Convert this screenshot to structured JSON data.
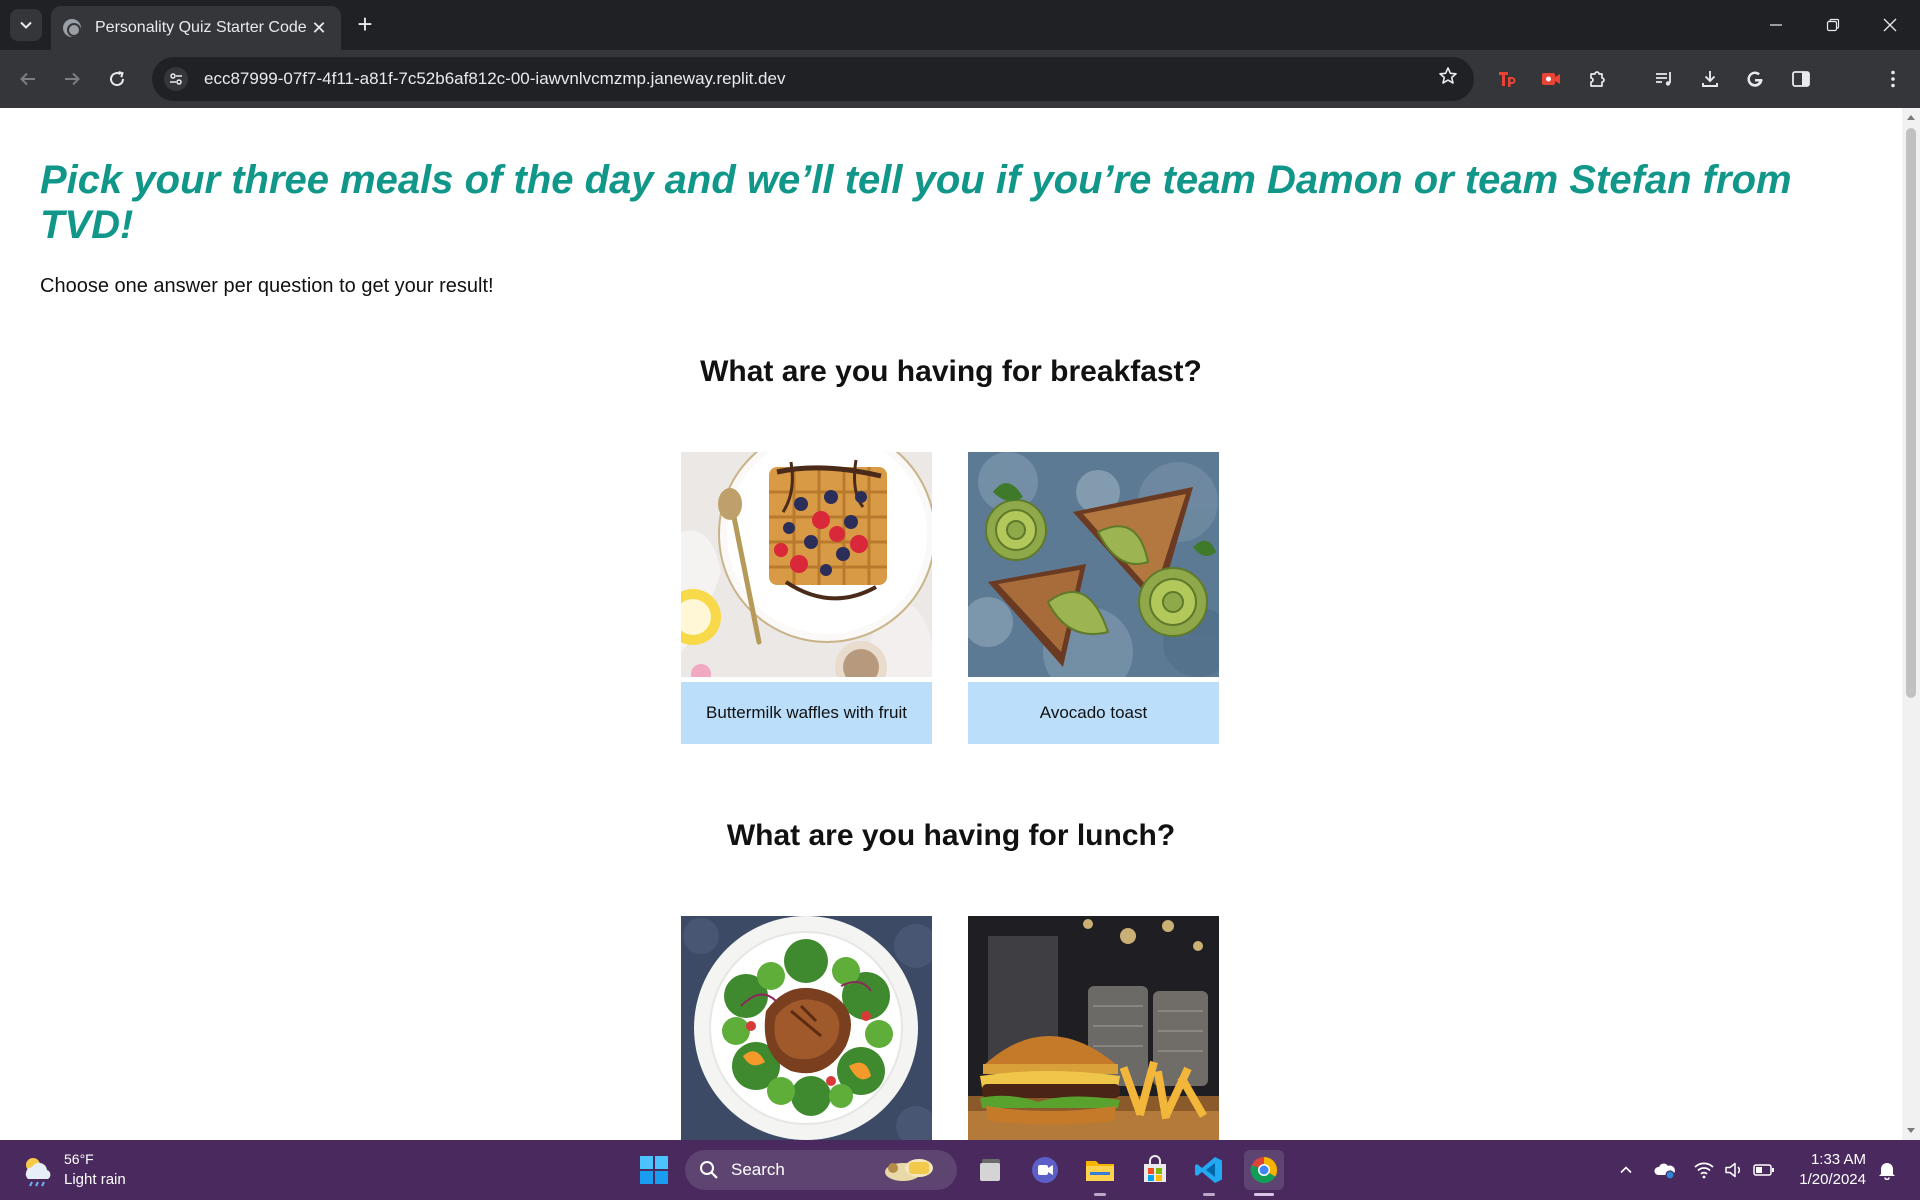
{
  "browser": {
    "tab_title": "Personality Quiz Starter Code",
    "url": "ecc87999-07f7-4f11-a81f-7c52b6af812c-00-iawvnlvcmzmp.janeway.replit.dev"
  },
  "page": {
    "title": "Pick your three meals of the day and we’ll tell you if you’re team Damon or team Stefan from TVD!",
    "subtitle": "Choose one answer per question to get your result!",
    "questions": [
      {
        "heading": "What are you having for breakfast?",
        "answers": [
          {
            "label": "Buttermilk waffles with fruit",
            "image": "waffles-photo"
          },
          {
            "label": "Avocado toast",
            "image": "avocado-toast-photo"
          }
        ]
      },
      {
        "heading": "What are you having for lunch?",
        "answers": [
          {
            "label": "",
            "image": "chicken-salad-photo"
          },
          {
            "label": "",
            "image": "burger-fries-photo"
          }
        ]
      }
    ]
  },
  "taskbar": {
    "weather_temp": "56°F",
    "weather_condition": "Light rain",
    "search_label": "Search",
    "time": "1:33 AM",
    "date": "1/20/2024"
  },
  "colors": {
    "title": "#11978a",
    "answer_label_bg": "#bbdefb",
    "taskbar_bg": "#4a2a5e",
    "chrome_dark": "#202124",
    "chrome_toolbar": "#35363a"
  }
}
